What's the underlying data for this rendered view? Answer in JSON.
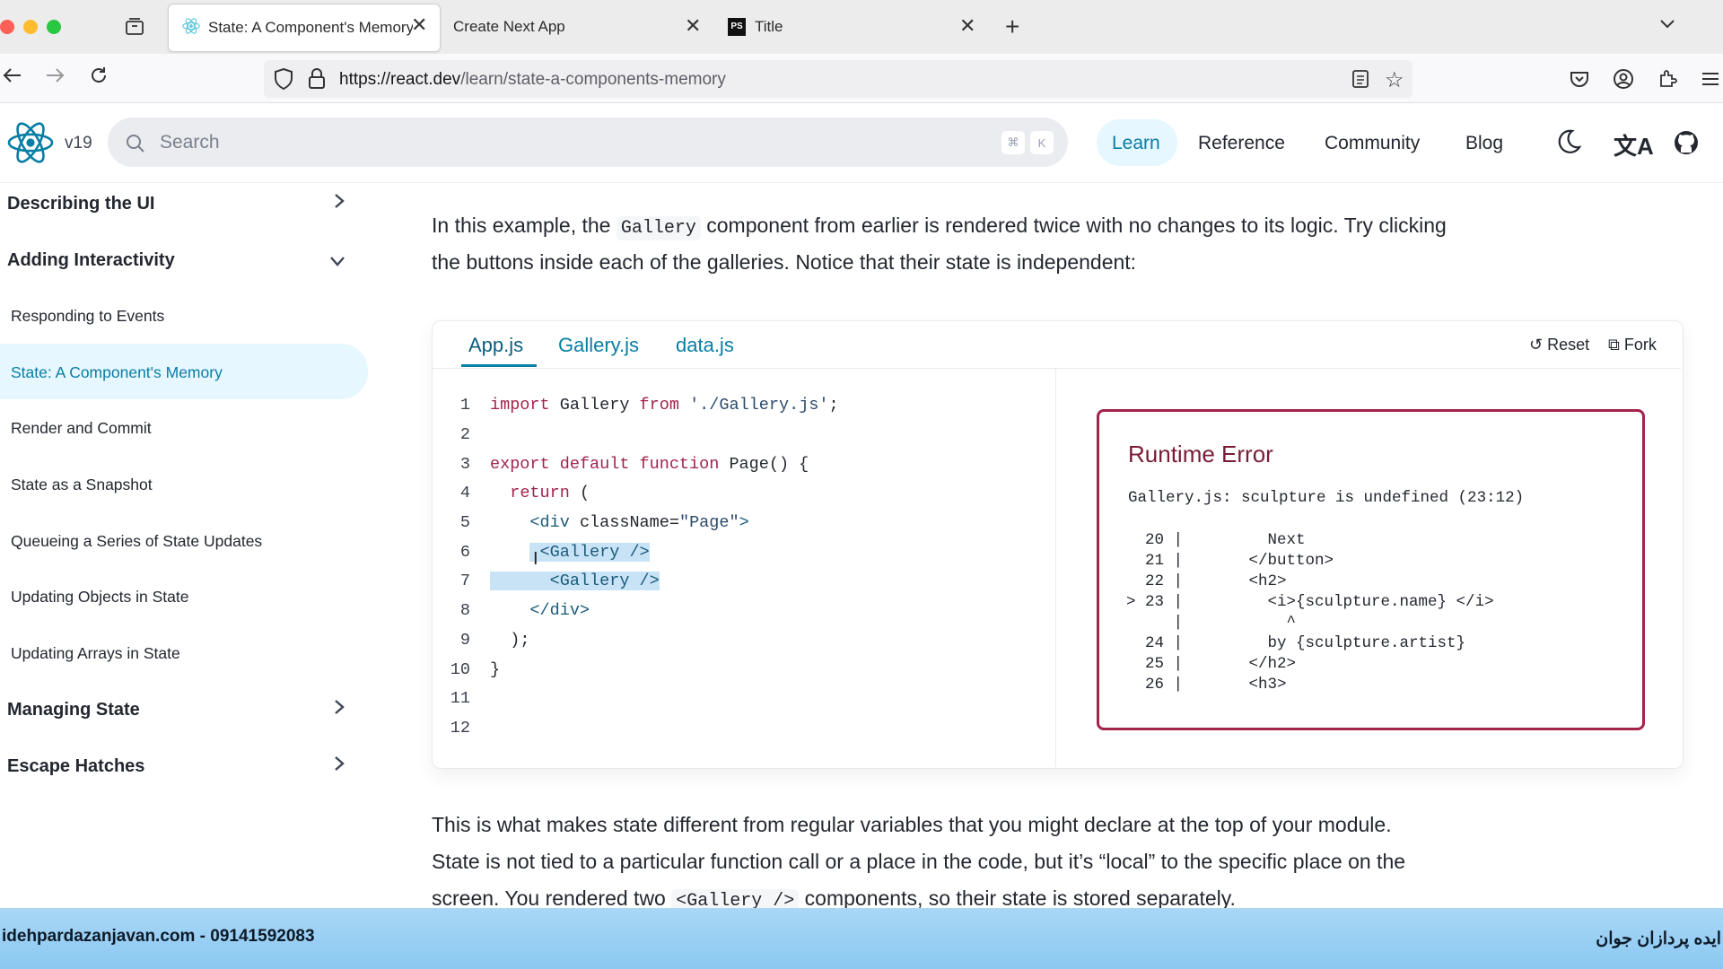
{
  "browser": {
    "tabs": [
      {
        "label": "State: A Component's Memory -",
        "active": true
      },
      {
        "label": "Create Next App",
        "active": false
      },
      {
        "label": "Title",
        "active": false
      }
    ],
    "url_host": "https://react.dev",
    "url_path": "/learn/state-a-components-memory"
  },
  "site": {
    "version": "v19",
    "search_placeholder": "Search",
    "kbd_cmd": "⌘",
    "kbd_k": "K",
    "nav": [
      "Learn",
      "Reference",
      "Community",
      "Blog"
    ]
  },
  "sidebar": {
    "sections": [
      {
        "label": "Describing the UI"
      },
      {
        "label": "Adding Interactivity"
      },
      {
        "label": "Managing State"
      },
      {
        "label": "Escape Hatches"
      }
    ],
    "items": [
      "Responding to Events",
      "State: A Component's Memory",
      "Render and Commit",
      "State as a Snapshot",
      "Queueing a Series of State Updates",
      "Updating Objects in State",
      "Updating Arrays in State"
    ]
  },
  "content": {
    "intro_a": "In this example, the ",
    "intro_code": "Gallery",
    "intro_b": " component from earlier is rendered twice with no changes to its logic. Try clicking",
    "intro_line2": "the buttons inside each of the galleries. Notice that their state is independent:",
    "outro_line1": "This is what makes state different from regular variables that you might declare at the top of your module.",
    "outro_line2": "State is not tied to a particular function call or a place in the code, but it’s “local” to the specific place on the",
    "outro_line3_a": "screen. You rendered two ",
    "outro_code": "<Gallery />",
    "outro_line3_b": " components, so their state is stored separately."
  },
  "sandbox": {
    "tabs": [
      "App.js",
      "Gallery.js",
      "data.js"
    ],
    "reset": "Reset",
    "fork": "Fork",
    "code": {
      "l1_kw1": "import",
      "l1_mid": " Gallery ",
      "l1_kw2": "from",
      "l1_str": " './Gallery.js'",
      "l1_end": ";",
      "l3_kw": "export default function",
      "l3_rest": " Page() {",
      "l4_kw": "return",
      "l4_rest": " (",
      "l5_tag": "<div",
      "l5_attr": " className=",
      "l5_str": "\"Page\"",
      "l5_end": ">",
      "l6": "<Gallery />",
      "l7": "<Gallery />",
      "l8": "</div>",
      "l9": ");",
      "l10": "}"
    },
    "line_numbers": [
      "1",
      "2",
      "3",
      "4",
      "5",
      "6",
      "7",
      "8",
      "9",
      "10",
      "11",
      "12"
    ],
    "error": {
      "title": "Runtime Error",
      "message": "Gallery.js: sculpture is undefined (23:12)",
      "lines": [
        "  20 |         Next",
        "  21 |       </button>",
        "  22 |       <h2>",
        "> 23 |         <i>{sculpture.name} </i>",
        "     |           ^",
        "  24 |         by {sculpture.artist}",
        "  25 |       </h2>",
        "  26 |       <h3>"
      ]
    }
  },
  "banner": {
    "left": "idehpardazanjavan.com - 09141592083",
    "right": "ایده پردازان جوان"
  }
}
